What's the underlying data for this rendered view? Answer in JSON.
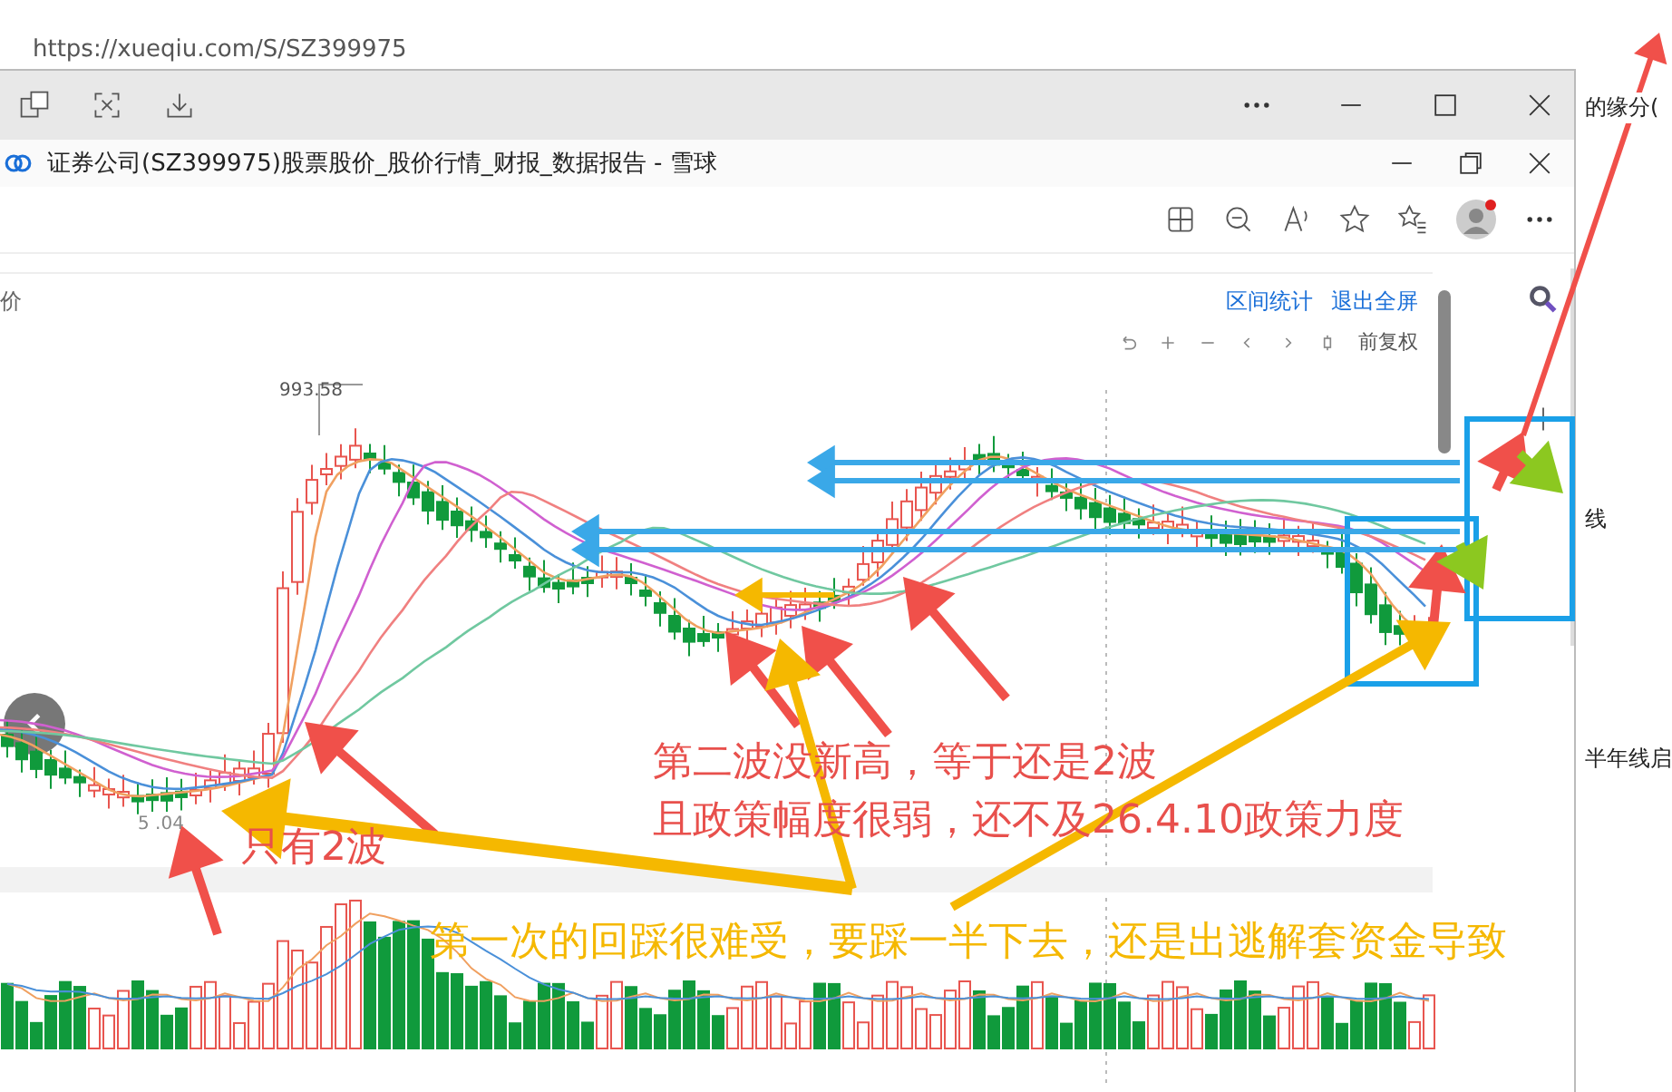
{
  "back_window": {
    "url": "https://xueqiu.com/S/SZ399975",
    "side_texts": [
      "的缘分(",
      "线",
      "半年线启"
    ]
  },
  "window": {
    "title": "证券公司(SZ399975)股票股价_股价行情_财报_数据报告 - 雪球"
  },
  "chart_panel": {
    "left_label": "价",
    "links": [
      "区间统计",
      "退出全屏"
    ],
    "adjust_label": "前复权",
    "high_label": "993.58",
    "low_label": "5 .04"
  },
  "annotations": [
    {
      "kind": "red",
      "text": "第二波没新高，等于还是2波"
    },
    {
      "kind": "red",
      "text": "且政策幅度很弱，还不及26.4.10政策力度"
    },
    {
      "kind": "red",
      "text": "只有2波"
    },
    {
      "kind": "yellow",
      "text": "第一次的回踩很难受，要踩一半下去，还是出逃解套资金导致"
    }
  ]
}
